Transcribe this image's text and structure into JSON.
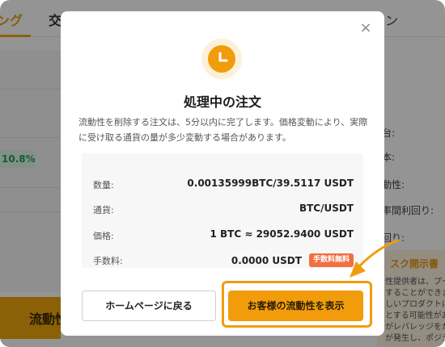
{
  "background": {
    "tabs": [
      {
        "label": "ング"
      },
      {
        "label": "交"
      },
      {
        "label": "ン"
      }
    ],
    "percent_badge": "10.8%",
    "left_button_label": "流動性",
    "right_labels": [
      "台:",
      "本:",
      "動性:",
      "率間利回り:",
      "回り:"
    ],
    "risk": {
      "title": "スク開示書",
      "lines": [
        "性提供者は、プール",
        "することができます。",
        "しいプロダクトにおけ",
        "とする可能性があり",
        "がレバレッジをかけ",
        "が発生し、ポジションが"
      ]
    }
  },
  "dialog": {
    "close_glyph": "×",
    "icon": "clock-icon",
    "title": "処理中の注文",
    "description": "流動性を削除する注文は、5分以内に完了します。価格変動により、実際に受け取る通貨の量が多少変動する場合があります。",
    "details": {
      "quantity": {
        "label": "数量:",
        "value": "0.00135999BTC/39.5117 USDT"
      },
      "currency": {
        "label": "通貨:",
        "value": "BTC/USDT"
      },
      "price": {
        "label": "価格:",
        "value": "1 BTC ≈ 29052.9400 USDT"
      },
      "fee": {
        "label": "手数料:",
        "value": "0.0000 USDT",
        "badge": "手数料無料"
      }
    },
    "buttons": {
      "home": "ホームページに戻る",
      "show_liquidity": "お客様の流動性を表示"
    }
  },
  "colors": {
    "accent": "#f29c0c",
    "badge": "#f07042",
    "overlay": "rgba(0,0,0,0.42)"
  }
}
